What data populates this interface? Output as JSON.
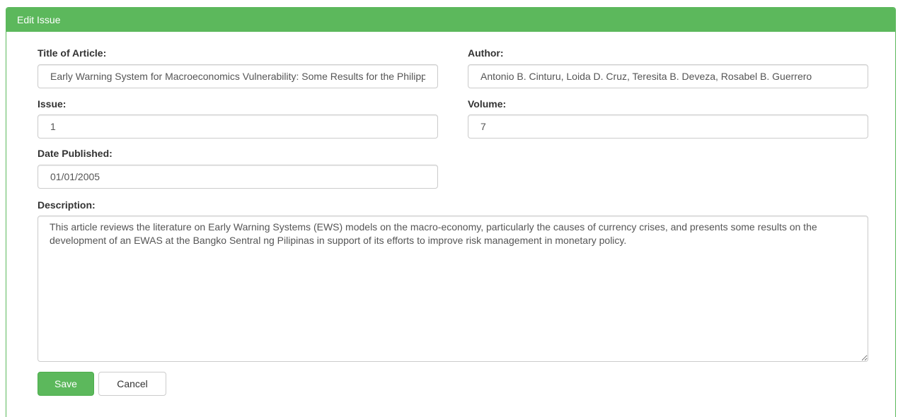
{
  "panel": {
    "title": "Edit Issue"
  },
  "form": {
    "title_label": "Title of Article:",
    "title_value": "Early Warning System for Macroeconomics Vulnerability: Some Results for the Philippines",
    "author_label": "Author:",
    "author_value": "Antonio B. Cinturu, Loida D. Cruz, Teresita B. Deveza, Rosabel B. Guerrero",
    "issue_label": "Issue:",
    "issue_value": "1",
    "volume_label": "Volume:",
    "volume_value": "7",
    "date_label": "Date Published:",
    "date_value": "01/01/2005",
    "description_label": "Description:",
    "description_value": "This article reviews the literature on Early Warning Systems (EWS) models on the macro-economy, particularly the causes of currency crises, and presents some results on the development of an EWAS at the Bangko Sentral ng Pilipinas in support of its efforts to improve risk management in monetary policy."
  },
  "buttons": {
    "save_label": "Save",
    "cancel_label": "Cancel"
  },
  "colors": {
    "accent": "#5cb85c",
    "border": "#cccccc"
  }
}
